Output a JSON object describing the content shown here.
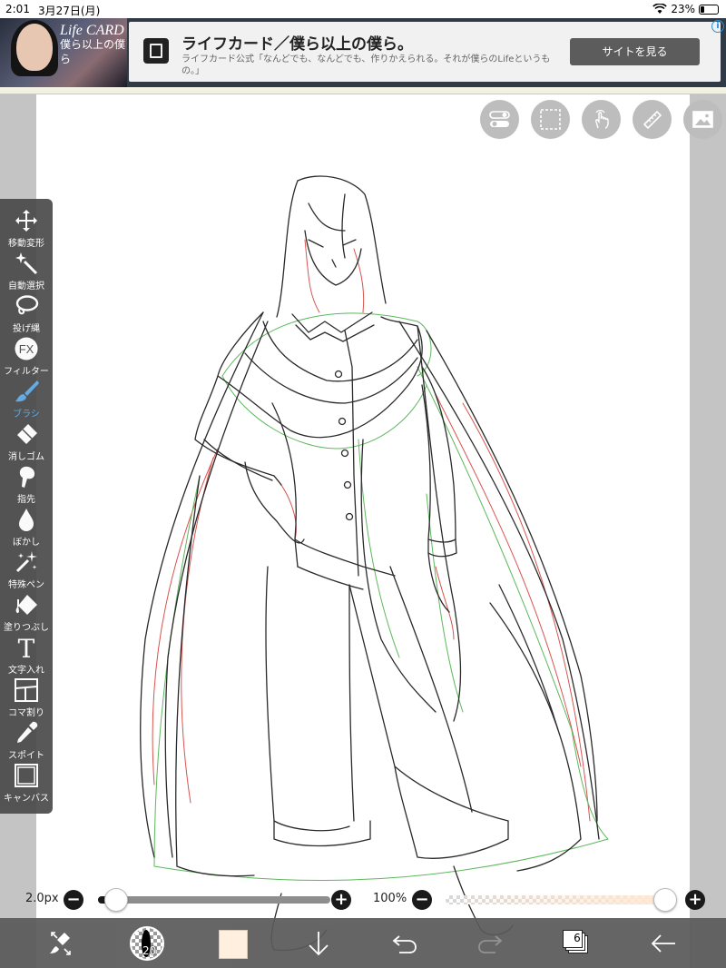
{
  "status_bar": {
    "time": "2:01",
    "date": "3月27日(月)",
    "battery": "23%",
    "battery_level": 0.23
  },
  "ad": {
    "logo_text": "Life CARD",
    "logo_subtext": "僕ら以上の僕ら",
    "title": "ライフカード／僕ら以上の僕ら。",
    "description": "ライフカード公式「なんどでも、なんどでも、作りかえられる。それが僕らのLifeというもの。」",
    "cta": "サイトを見る",
    "choice_icon": "i"
  },
  "top_tools": [
    {
      "name": "toggle-icon"
    },
    {
      "name": "selection-icon"
    },
    {
      "name": "touch-icon"
    },
    {
      "name": "ruler-icon"
    },
    {
      "name": "image-icon"
    }
  ],
  "left_toolbar": {
    "items": [
      {
        "label": "移動変形",
        "icon": "move-icon"
      },
      {
        "label": "自動選択",
        "icon": "magic-wand-icon"
      },
      {
        "label": "投げ縄",
        "icon": "lasso-icon"
      },
      {
        "label": "フィルター",
        "icon": "fx-icon",
        "glyph": "FX"
      },
      {
        "label": "ブラシ",
        "icon": "brush-icon",
        "active": true
      },
      {
        "label": "消しゴム",
        "icon": "eraser-icon"
      },
      {
        "label": "指先",
        "icon": "finger-icon"
      },
      {
        "label": "ぼかし",
        "icon": "blur-drop-icon"
      },
      {
        "label": "特殊ペン",
        "icon": "special-pen-icon"
      },
      {
        "label": "塗りつぶし",
        "icon": "fill-bucket-icon"
      },
      {
        "label": "文字入れ",
        "icon": "text-icon",
        "glyph": "T"
      },
      {
        "label": "コマ割り",
        "icon": "panel-split-icon"
      },
      {
        "label": "スポイト",
        "icon": "eyedropper-icon"
      },
      {
        "label": "キャンバス",
        "icon": "canvas-icon"
      }
    ]
  },
  "sliders": {
    "size_label": "2.0px",
    "size_value": 0.05,
    "opacity_label": "100%",
    "opacity_value": 1.0,
    "minus": "−",
    "plus": "+"
  },
  "bottom_bar": {
    "brush_size_num": "20",
    "layer_count": "6",
    "color": "#ffefdf"
  },
  "colors": {
    "accent": "#5aa9e6",
    "toolbar_bg": "#4a4a4a",
    "sketch_red": "#d9534f",
    "sketch_green": "#5cb85c"
  }
}
